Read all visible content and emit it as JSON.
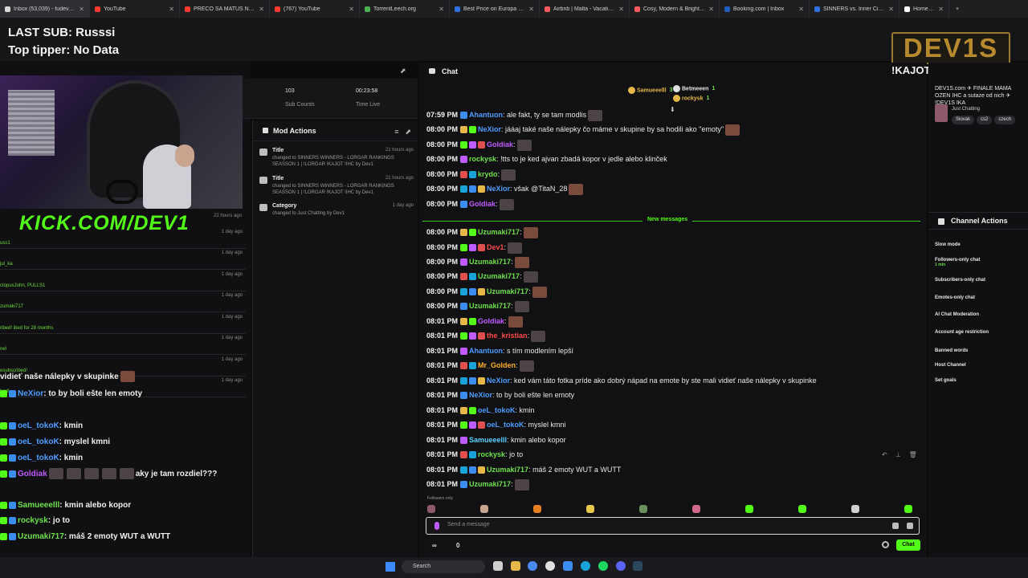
{
  "browser": {
    "tabs": [
      {
        "label": "Inbox (53,039) - fudev1@gm",
        "color": "#d9d9d9"
      },
      {
        "label": "YouTube",
        "color": "#ff3b30"
      },
      {
        "label": "PREČO SA MATÚŠ NA RANDE",
        "color": "#ff3b30"
      },
      {
        "label": "(767) YouTube",
        "color": "#ff3b30"
      },
      {
        "label": "TorrentLeech.org",
        "color": "#4caf50"
      },
      {
        "label": "Best Price on Europa Hotel",
        "color": "#2f6fe0"
      },
      {
        "label": "Airbnb | Malta - Vacation Rentals",
        "color": "#ff5a5f"
      },
      {
        "label": "Cosy, Modern & Bright Centr",
        "color": "#ff5a5f"
      },
      {
        "label": "Booking.com | Inbox",
        "color": "#1f5fbf"
      },
      {
        "label": "SINNERS vs. Inner Circle Acade",
        "color": "#2f6fe0"
      },
      {
        "label": "Home / X",
        "color": "#ffffff"
      }
    ]
  },
  "overlay": {
    "last_sub": "LAST SUB: Russsi",
    "top_tipper": "Top tipper: No Data",
    "logo": "DEV1S"
  },
  "left_panel": {
    "kick_text": "KICK.COM/DEV1",
    "webcam_time": "22 hours ago",
    "events": [
      {
        "name": "uss1",
        "when": "1 day ago"
      },
      {
        "name": "jul_ka",
        "when": "1 day ago"
      },
      {
        "name": "ctopusJohn, PULLS1",
        "when": "1 day ago"
      },
      {
        "name": "zumaki717",
        "when": "1 day ago"
      },
      {
        "name": "ribed! ibed for 28 months",
        "when": "1 day ago"
      },
      {
        "name": "nel",
        "when": "1 day ago"
      },
      {
        "name": "esubscribed!",
        "when": "1 day ago"
      },
      {
        "name": "bed!",
        "when": "1 day ago"
      }
    ],
    "chat_lines": [
      {
        "user": "",
        "text": "vidieť naše nálepky v skupinke"
      },
      {
        "user": "NeXior",
        "text": ": to by boli ešte len emoty"
      },
      {
        "user": "oeL_tokoK",
        "text": ": kmin"
      },
      {
        "user": "oeL_tokoK",
        "text": ": myslel kmni"
      },
      {
        "user": "oeL_tokoK",
        "text": ": kmin"
      },
      {
        "user": "Goldiak",
        "text": "aky je tam rozdiel???"
      },
      {
        "user": "Samueeelll",
        "text": ": kmin alebo kopor"
      },
      {
        "user": "rockysk",
        "text": ": jo to"
      },
      {
        "user": "Uzumaki717",
        "text": ": máš 2 emoty WUT a WUTT"
      },
      {
        "user": "Uzumaki717",
        "text": ":"
      }
    ]
  },
  "stats": {
    "subs_value": "103",
    "subs_label": "Sub Counts",
    "time_value": "00:23:58",
    "time_label": "Time Live"
  },
  "mod_actions": {
    "title": "Mod Actions",
    "items": [
      {
        "type": "Title",
        "ago": "21 hours ago",
        "line1": "changed to SINNERS WINNERS - LORGAR RANKINGS",
        "line2": "SEASSON 1 | !LORGAR !KAJOT !IHC by Dev1"
      },
      {
        "type": "Title",
        "ago": "21 hours ago",
        "line1": "changed to SINNERS WINNERS - LORGAR RANKINGS",
        "line2": "SEASSON 1 | !LORGAR !KAJOT !IHC by Dev1"
      },
      {
        "type": "Category",
        "ago": "1 day ago",
        "line1": "changed to Just Chatting by Dev1",
        "line2": ""
      }
    ]
  },
  "chat": {
    "title": "Chat",
    "commands": "!KAJOT!IHC!DEV1S",
    "pinned": [
      {
        "name": "Samueeelll",
        "count": "3"
      },
      {
        "name": "Betmeeen",
        "count": "1"
      },
      {
        "name": "rockysk",
        "count": "1"
      }
    ],
    "new_messages_label": "New messages",
    "messages": [
      {
        "time": "07:59 PM",
        "user": "Ahantuon",
        "cls": "uname-blue",
        "text": ": ale fakt, ty se tam modlis"
      },
      {
        "time": "08:00 PM",
        "user": "NeXior",
        "cls": "uname-blue",
        "text": ": jááaj  také naše nálepky čo máme v skupine by sa hodili ako \"emoty\""
      },
      {
        "time": "08:00 PM",
        "user": "Goldiak",
        "cls": "uname-purple",
        "text": ":"
      },
      {
        "time": "08:00 PM",
        "user": "rockysk",
        "cls": "uname-green",
        "text": ": !tts to je ked ajvan zbadá kopor v jedle alebo klinček"
      },
      {
        "time": "08:00 PM",
        "user": "krydo",
        "cls": "uname-green",
        "text": ":"
      },
      {
        "time": "08:00 PM",
        "user": "NeXior",
        "cls": "uname-blue",
        "text": ": však @TitaN_28"
      },
      {
        "time": "08:00 PM",
        "user": "Goldiak",
        "cls": "uname-purple",
        "text": ":"
      },
      {
        "time": "08:00 PM",
        "user": "Uzumaki717",
        "cls": "uname-green",
        "text": ":"
      },
      {
        "time": "08:00 PM",
        "user": "Dev1",
        "cls": "uname-red",
        "text": ":"
      },
      {
        "time": "08:00 PM",
        "user": "Uzumaki717",
        "cls": "uname-green",
        "text": ":"
      },
      {
        "time": "08:00 PM",
        "user": "Uzumaki717",
        "cls": "uname-green",
        "text": ":"
      },
      {
        "time": "08:00 PM",
        "user": "Uzumaki717",
        "cls": "uname-green",
        "text": ":"
      },
      {
        "time": "08:00 PM",
        "user": "Uzumaki717",
        "cls": "uname-green",
        "text": ":"
      },
      {
        "time": "08:01 PM",
        "user": "Goldiak",
        "cls": "uname-purple",
        "text": ":"
      },
      {
        "time": "08:01 PM",
        "user": "the_kristian",
        "cls": "uname-red",
        "text": ":"
      },
      {
        "time": "08:01 PM",
        "user": "Ahantuon",
        "cls": "uname-blue",
        "text": ": s tím modlením lepší"
      },
      {
        "time": "08:01 PM",
        "user": "Mr_Golden",
        "cls": "uname-orange",
        "text": ":"
      },
      {
        "time": "08:01 PM",
        "user": "NeXior",
        "cls": "uname-blue",
        "text": ": ked vám táto fotka príde ako dobrý nápad na emote  by ste mali vidieť naše nálepky v skupinke"
      },
      {
        "time": "08:01 PM",
        "user": "NeXior",
        "cls": "uname-blue",
        "text": ": to by boli ešte len emoty"
      },
      {
        "time": "08:01 PM",
        "user": "oeL_tokoK",
        "cls": "uname-blue",
        "text": ": kmin"
      },
      {
        "time": "08:01 PM",
        "user": "oeL_tokoK",
        "cls": "uname-blue",
        "text": ": myslel kmni"
      },
      {
        "time": "08:01 PM",
        "user": "Samueeelll",
        "cls": "uname-cyan",
        "text": ": kmin alebo kopor"
      },
      {
        "time": "08:01 PM",
        "user": "rockysk",
        "cls": "uname-green",
        "text": ": jo to"
      },
      {
        "time": "08:01 PM",
        "user": "Uzumaki717",
        "cls": "uname-green",
        "text": ": máš 2 emoty WUT a WUTT"
      },
      {
        "time": "08:01 PM",
        "user": "Uzumaki717",
        "cls": "uname-green",
        "text": ":"
      }
    ],
    "followers_only": "Followers only",
    "input_placeholder": "Send a message",
    "footer_a": "∞",
    "footer_b": "0",
    "send_label": "Chat"
  },
  "right_panel": {
    "stream_title": "DEV1S.com ✈ FINALE MAMA OZEN IHC a sutaze od nich ✈ !DEV1S IKA",
    "category": "Just Chatting",
    "tags": [
      "Slovak",
      "cs2",
      "czech"
    ],
    "channel_actions_title": "Channel Actions",
    "actions": [
      {
        "label": "Slow mode",
        "sub": ""
      },
      {
        "label": "Followers-only chat",
        "sub": "1 min"
      },
      {
        "label": "Subscribers-only chat",
        "sub": ""
      },
      {
        "label": "Emotes-only chat",
        "sub": ""
      },
      {
        "label": "AI Chat Moderation",
        "sub": ""
      },
      {
        "label": "Account age restriction",
        "sub": ""
      },
      {
        "label": "Banned words",
        "sub": ""
      },
      {
        "label": "Host Channel",
        "sub": ""
      },
      {
        "label": "Set goals",
        "sub": ""
      }
    ]
  },
  "taskbar": {
    "search_label": "Search"
  }
}
